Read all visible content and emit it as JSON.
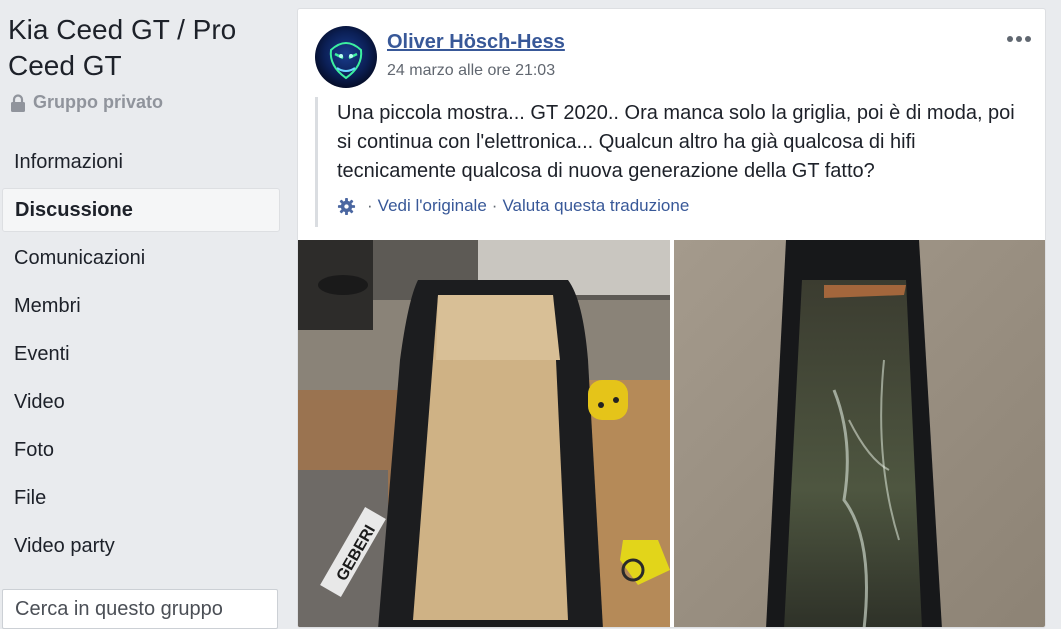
{
  "group": {
    "title": "Kia Ceed GT / Pro Ceed GT",
    "privacy": "Gruppo privato"
  },
  "nav": {
    "items": [
      {
        "label": "Informazioni"
      },
      {
        "label": "Discussione"
      },
      {
        "label": "Comunicazioni"
      },
      {
        "label": "Membri"
      },
      {
        "label": "Eventi"
      },
      {
        "label": "Video"
      },
      {
        "label": "Foto"
      },
      {
        "label": "File"
      },
      {
        "label": "Video party"
      }
    ],
    "active_label": "Discussione"
  },
  "search": {
    "placeholder": "Cerca in questo gruppo"
  },
  "post": {
    "author": "Oliver Hösch-Hess",
    "timestamp": "24 marzo alle ore 21:03",
    "text": "Una piccola mostra... GT 2020.. Ora manca solo la griglia, poi è di moda, poi si continua con l'elettronica... Qualcun altro ha già qualcosa di hifi tecnicamente qualcosa di nuova generazione della GT fatto?",
    "translation": {
      "separator": "·",
      "view_original": "Vedi l'originale",
      "rate_translation": "Valuta questa traduzione"
    },
    "photo_text": "GEBERI"
  },
  "icons": {
    "lock": "lock-icon",
    "search": "search-icon",
    "more": "more-options-icon",
    "gear": "gear-icon"
  },
  "colors": {
    "link": "#385898",
    "background": "#e9ebee",
    "secondary_text": "#616770",
    "primary_text": "#1d2129"
  }
}
